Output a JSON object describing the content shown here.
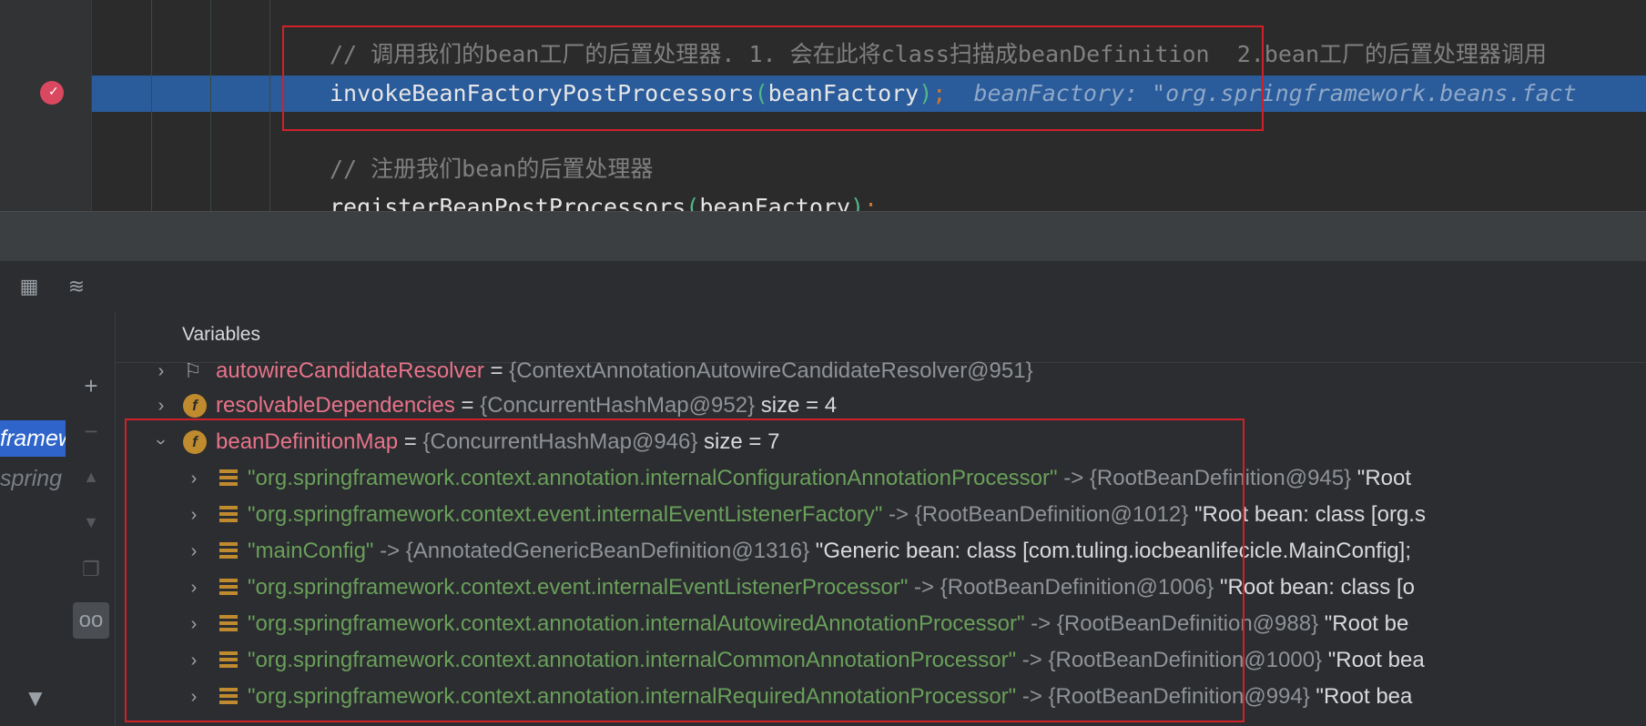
{
  "editor": {
    "comment1": "// 调用我们的bean工厂的后置处理器. 1. 会在此将class扫描成beanDefinition  2.bean工厂的后置处理器调用",
    "line1_fn": "invokeBeanFactoryPostProcessors",
    "line1_open": "(",
    "line1_arg": "beanFactory",
    "line1_close": ")",
    "line1_semi": ";",
    "line1_hint": "beanFactory: \"org.springframework.beans.fact",
    "comment2": "// 注册我们bean的后置处理器",
    "line2_fn": "registerBeanPostProcessors",
    "line2_open": "(",
    "line2_arg": "beanFactory",
    "line2_close": ")",
    "line2_semi": ";"
  },
  "debugger": {
    "panel_title": "Variables",
    "frames": {
      "selected": "framew",
      "next": "spring"
    },
    "icons": {
      "table": "table-icon",
      "threads": "threads-icon",
      "filter": "filter-icon",
      "add": "plus-icon",
      "remove": "minus-icon",
      "up": "arrow-up-icon",
      "down": "arrow-down-icon",
      "copy": "copy-icon",
      "watch": "glasses-icon"
    }
  },
  "variables": [
    {
      "name": "autowireCandidateResolver",
      "eq": " = ",
      "obj": "{ContextAnnotationAutowireCandidateResolver@951}",
      "extra": ""
    },
    {
      "name": "resolvableDependencies",
      "eq": " = ",
      "obj": "{ConcurrentHashMap@952}",
      "extra": "  size = 4"
    },
    {
      "name": "beanDefinitionMap",
      "eq": " = ",
      "obj": "{ConcurrentHashMap@946}",
      "extra": "  size = 7"
    }
  ],
  "entries": [
    {
      "key": "\"org.springframework.context.annotation.internalConfigurationAnnotationProcessor\"",
      "arrow": " -> ",
      "obj": "{RootBeanDefinition@945}",
      "desc": " \"Root"
    },
    {
      "key": "\"org.springframework.context.event.internalEventListenerFactory\"",
      "arrow": " -> ",
      "obj": "{RootBeanDefinition@1012}",
      "desc": " \"Root bean: class [org.s"
    },
    {
      "key": "\"mainConfig\"",
      "arrow": " -> ",
      "obj": "{AnnotatedGenericBeanDefinition@1316}",
      "desc": " \"Generic bean: class [com.tuling.iocbeanlifecicle.MainConfig];"
    },
    {
      "key": "\"org.springframework.context.event.internalEventListenerProcessor\"",
      "arrow": " -> ",
      "obj": "{RootBeanDefinition@1006}",
      "desc": " \"Root bean: class [o"
    },
    {
      "key": "\"org.springframework.context.annotation.internalAutowiredAnnotationProcessor\"",
      "arrow": " -> ",
      "obj": "{RootBeanDefinition@988}",
      "desc": " \"Root be"
    },
    {
      "key": "\"org.springframework.context.annotation.internalCommonAnnotationProcessor\"",
      "arrow": " -> ",
      "obj": "{RootBeanDefinition@1000}",
      "desc": " \"Root bea"
    },
    {
      "key": "\"org.springframework.context.annotation.internalRequiredAnnotationProcessor\"",
      "arrow": " -> ",
      "obj": "{RootBeanDefinition@994}",
      "desc": " \"Root bea"
    }
  ]
}
